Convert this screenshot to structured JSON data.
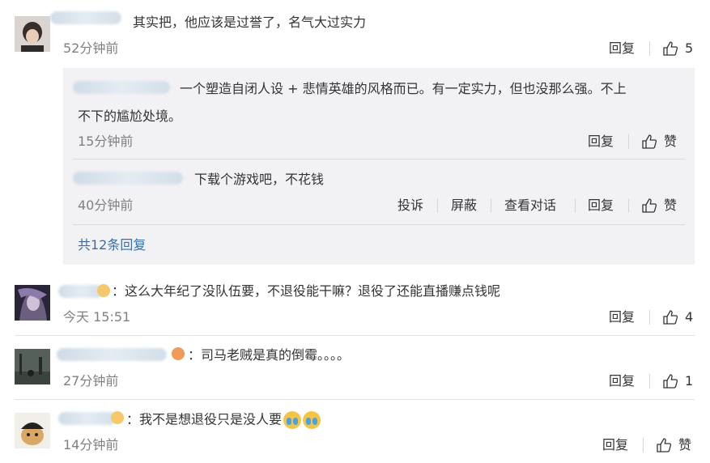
{
  "comments": [
    {
      "text": "其实把，他应该是过誉了，名气大过实力",
      "time": "52分钟前",
      "reply_label": "回复",
      "likes": "5",
      "replies": [
        {
          "text_line1": "一个塑造自闭人设 + 悲情英雄的风格而已。有一定实力，但也没那么强。不上",
          "text_line2": "不下的尴尬处境。",
          "time": "15分钟前",
          "reply_label": "回复",
          "like_label": "赞"
        },
        {
          "text": "下载个游戏吧，不花钱",
          "time": "40分钟前",
          "report_label": "投诉",
          "block_label": "屏蔽",
          "view_conversation_label": "查看对话",
          "reply_label": "回复",
          "like_label": "赞"
        }
      ],
      "more_replies": "共12条回复"
    },
    {
      "text": "：这么大年纪了没队伍要，不退役能干嘛？退役了还能直播赚点钱呢",
      "time": "今天 15:51",
      "reply_label": "回复",
      "likes": "4"
    },
    {
      "text": "：司马老贼是真的倒霉。。。。",
      "time": "27分钟前",
      "reply_label": "回复",
      "likes": "1"
    },
    {
      "text": "：我不是想退役只是没人要",
      "time": "14分钟前",
      "reply_label": "回复",
      "like_label": "赞"
    }
  ],
  "colors": {
    "link": "#3a6ea5",
    "reply_bg": "#f2f2f5",
    "time": "#808080"
  }
}
